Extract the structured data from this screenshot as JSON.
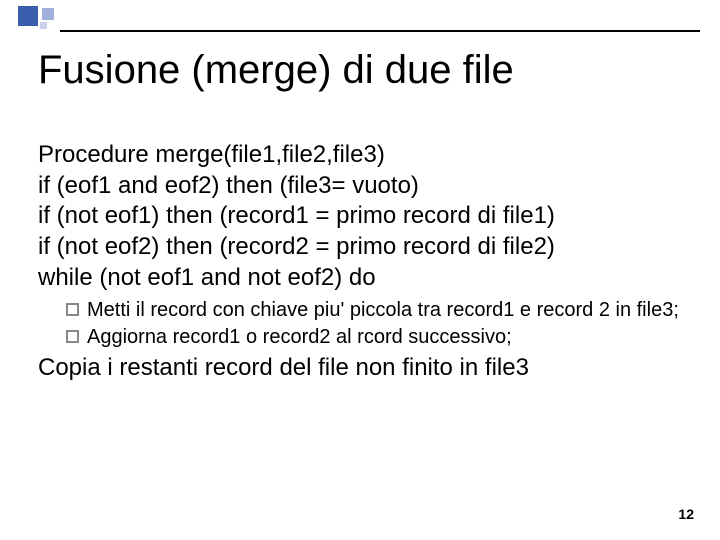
{
  "title": "Fusione (merge) di due file",
  "lines": {
    "l1": "Procedure merge(file1,file2,file3)",
    "l2": "if (eof1 and eof2) then (file3= vuoto)",
    "l3": "if (not eof1) then (record1 = primo record di file1)",
    "l4": "if (not eof2) then (record2 = primo record di file2)",
    "l5": "while (not eof1 and not eof2) do"
  },
  "sub": {
    "s1": "Metti il record con chiave piu' piccola tra record1 e record 2 in file3;",
    "s2": "Aggiorna record1 o record2 al rcord successivo;"
  },
  "final": "Copia i restanti record del file non finito in file3",
  "page": "12"
}
